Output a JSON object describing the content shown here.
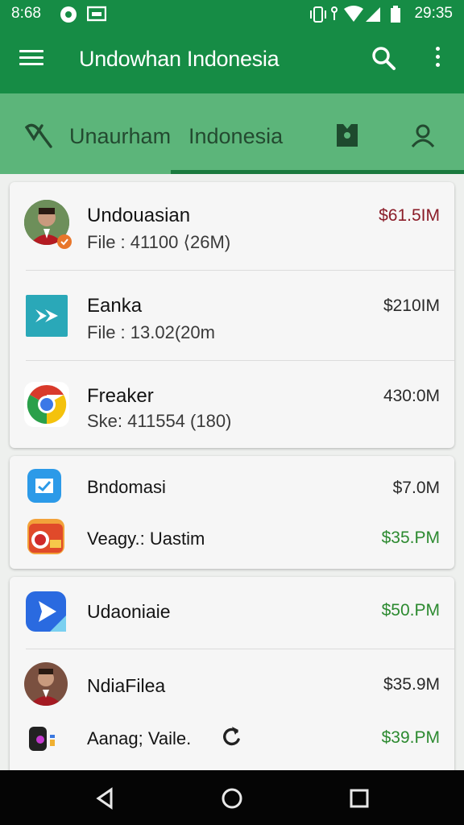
{
  "status_bar": {
    "time": "8:68",
    "clock": "29:35"
  },
  "app_bar": {
    "title": "Undowhan Indonesia"
  },
  "tabs": [
    {
      "label": "Unaurham"
    },
    {
      "label": "Indonesia"
    }
  ],
  "cards": [
    {
      "rows": [
        {
          "name": "Undouasian",
          "sub": "File : 41100 ⟨26M)",
          "amount": "$61.5IM"
        },
        {
          "name": "Eanka",
          "sub": "File : 13.02(20m",
          "amount": "$210IM"
        },
        {
          "name": "Freaker",
          "sub": "Ske: 411554 (180)",
          "amount": "430:0M"
        }
      ]
    },
    {
      "rows": [
        {
          "name": "Bndomasi",
          "amount": "$7.0M"
        },
        {
          "name": "Veagy.: Uastim",
          "amount": "$35.PM"
        }
      ]
    },
    {
      "rows": [
        {
          "name": "Udaoniaie",
          "amount": "$50.PM"
        },
        {
          "name": "NdiaFilea",
          "amount": "$35.9M"
        },
        {
          "name": "Aanag; Vaile.",
          "amount": "$39.PM"
        }
      ]
    }
  ],
  "colors": {
    "primary": "#168c45",
    "tab_bar": "#5cb57a",
    "amount_red": "#8a1c28",
    "amount_green": "#2c8a30"
  }
}
